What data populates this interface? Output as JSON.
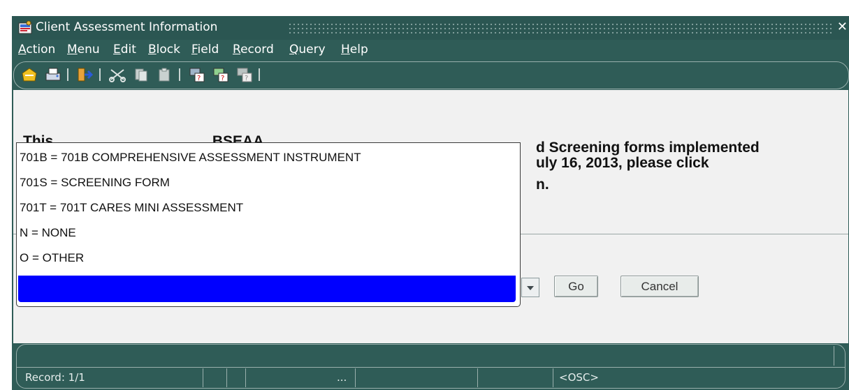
{
  "window": {
    "title": "Client Assessment Information",
    "close_glyph": "✕"
  },
  "menubar": {
    "items": [
      {
        "label": "Action",
        "accel": "A"
      },
      {
        "label": "Menu",
        "accel": "M"
      },
      {
        "label": "Edit",
        "accel": "E"
      },
      {
        "label": "Block",
        "accel": "B"
      },
      {
        "label": "Field",
        "accel": "F"
      },
      {
        "label": "Record",
        "accel": "R"
      },
      {
        "label": "Query",
        "accel": "Q"
      },
      {
        "label": "Help",
        "accel": "H"
      }
    ]
  },
  "toolbar": {
    "icons": [
      "save-icon",
      "print-icon",
      "exit-icon",
      "cut-icon",
      "copy-icon",
      "paste-icon",
      "query-icon",
      "query-execute-icon",
      "query-cancel-icon"
    ]
  },
  "message": {
    "line1_visible": "d Screening forms implemented",
    "line2_visible": "uly 16, 2013, please click",
    "line3_visible": "n.",
    "line1_partial_left": "This  ___  __  ___  ___  __  ___  BSEAA  ___________"
  },
  "dropdown": {
    "options": [
      "701B = 701B COMPREHENSIVE ASSESSMENT INSTRUMENT",
      "701S = SCREENING FORM",
      "701T = 701T CARES MINI ASSESSMENT",
      "N = NONE",
      "O = OTHER",
      ""
    ],
    "selected_index": 5
  },
  "buttons": {
    "go": "Go",
    "cancel": "Cancel"
  },
  "status": {
    "record": "Record: 1/1",
    "ellipsis": "...",
    "mode": "<OSC>"
  },
  "colors": {
    "frame": "#2f5c57",
    "selection": "#0000ff"
  }
}
